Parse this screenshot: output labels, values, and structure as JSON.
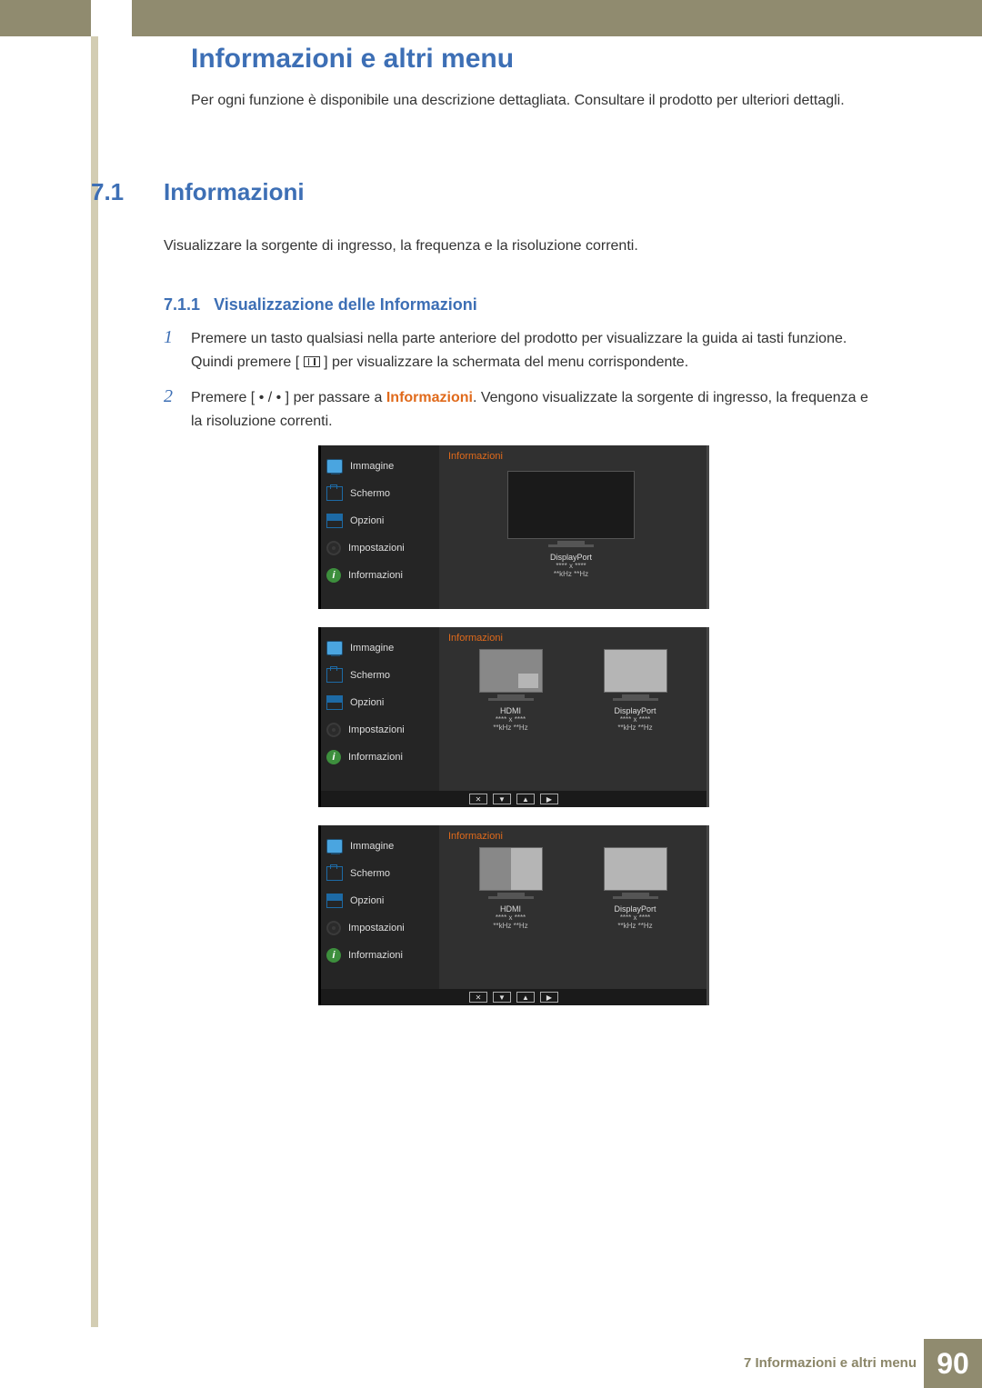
{
  "chapter_title": "Informazioni e altri menu",
  "intro": "Per ogni funzione è disponibile una descrizione dettagliata. Consultare il prodotto per ulteriori dettagli.",
  "section": {
    "num": "7.1",
    "title": "Informazioni"
  },
  "section_text": "Visualizzare la sorgente di ingresso, la frequenza e la risoluzione correnti.",
  "subsection": {
    "num": "7.1.1",
    "title": "Visualizzazione delle Informazioni"
  },
  "steps": {
    "s1_pre": "Premere un tasto qualsiasi nella parte anteriore del prodotto per visualizzare la guida ai tasti funzione. Quindi premere [ ",
    "s1_post": " ] per visualizzare la schermata del menu corrispondente.",
    "s2_pre": "Premere [ • / • ] per passare a ",
    "s2_accent": "Informazioni",
    "s2_post": ". Vengono visualizzate la sorgente di ingresso, la frequenza e la risoluzione correnti."
  },
  "osd": {
    "title": "Informazioni",
    "menu": {
      "immagine": "Immagine",
      "schermo": "Schermo",
      "opzioni": "Opzioni",
      "impostazioni": "Impostazioni",
      "informazioni": "Informazioni"
    },
    "single": {
      "port": "DisplayPort",
      "res": "**** x ****",
      "freq": "**kHz **Hz"
    },
    "dual": {
      "left": {
        "port": "HDMI",
        "res": "**** x ****",
        "freq": "**kHz **Hz"
      },
      "right": {
        "port": "DisplayPort",
        "res": "**** x ****",
        "freq": "**kHz **Hz"
      }
    },
    "nav": {
      "close": "✕",
      "down": "▼",
      "up": "▲",
      "right": "▶"
    }
  },
  "footer": {
    "text": "7 Informazioni e altri menu",
    "page": "90"
  },
  "icons": {
    "info_glyph": "i"
  }
}
